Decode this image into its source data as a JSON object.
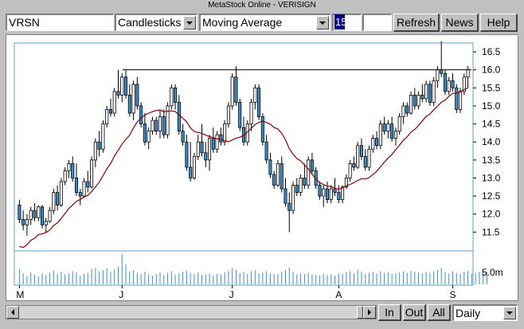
{
  "window": {
    "title": "MetaStock Online - VERISIGN"
  },
  "toolbar": {
    "symbol": "VRSN",
    "chart_type": "Candlesticks",
    "indicator": "Moving Average",
    "period": "15",
    "extra_field": "",
    "refresh_label": "Refresh",
    "news_label": "News",
    "help_label": "Help"
  },
  "footer": {
    "zoom_in_label": "In",
    "zoom_out_label": "Out",
    "all_label": "All",
    "interval": "Daily"
  },
  "icons": {
    "dropdown": "chevron-down-icon",
    "scroll_left": "arrow-left-icon",
    "scroll_right": "arrow-right-icon"
  },
  "colors": {
    "up": "#ffffff",
    "down": "#3a8fd0",
    "ma": "#8b0000",
    "frame": "#5ba0c8",
    "volume": "#3a8fd0",
    "resistance": "#000000"
  },
  "chart_data": {
    "type": "candlestick",
    "title": "",
    "symbol": "VRSN",
    "y_ticks": [
      "16.5",
      "16.0",
      "15.5",
      "15.0",
      "14.5",
      "14.0",
      "13.5",
      "13.0",
      "12.5",
      "12.0",
      "11.5"
    ],
    "y_range": [
      11.0,
      16.7
    ],
    "volume_label": "5.0m",
    "x_month_labels": [
      {
        "label": "M",
        "index": 0
      },
      {
        "label": "J",
        "index": 27
      },
      {
        "label": "J",
        "index": 56
      },
      {
        "label": "A",
        "index": 84
      },
      {
        "label": "S",
        "index": 114
      }
    ],
    "moving_average_period": 15,
    "resistance_level": 16.0,
    "resistance_from_index": 28,
    "candles": [
      [
        12.25,
        12.4,
        11.75,
        11.85
      ],
      [
        11.85,
        12.1,
        11.55,
        11.7
      ],
      [
        11.7,
        12.0,
        11.4,
        11.85
      ],
      [
        11.85,
        12.2,
        11.7,
        12.1
      ],
      [
        12.1,
        12.3,
        11.8,
        11.9
      ],
      [
        11.9,
        12.25,
        11.8,
        12.2
      ],
      [
        12.2,
        12.25,
        11.6,
        11.7
      ],
      [
        11.7,
        11.9,
        11.5,
        11.8
      ],
      [
        11.8,
        12.2,
        11.75,
        12.1
      ],
      [
        12.1,
        12.7,
        12.0,
        12.6
      ],
      [
        12.6,
        12.8,
        12.1,
        12.25
      ],
      [
        12.25,
        13.0,
        12.2,
        12.9
      ],
      [
        12.9,
        13.3,
        12.8,
        13.2
      ],
      [
        13.2,
        13.5,
        13.0,
        13.4
      ],
      [
        13.4,
        13.6,
        12.9,
        13.0
      ],
      [
        13.0,
        13.4,
        12.5,
        12.6
      ],
      [
        12.6,
        12.7,
        12.25,
        12.5
      ],
      [
        12.5,
        13.0,
        12.45,
        12.9
      ],
      [
        12.9,
        13.2,
        12.6,
        12.75
      ],
      [
        12.75,
        13.6,
        12.7,
        13.5
      ],
      [
        13.5,
        14.1,
        13.3,
        14.0
      ],
      [
        14.0,
        14.3,
        13.6,
        13.8
      ],
      [
        13.8,
        14.6,
        13.7,
        14.5
      ],
      [
        14.5,
        15.0,
        14.4,
        14.9
      ],
      [
        14.9,
        15.2,
        14.7,
        14.8
      ],
      [
        14.8,
        15.5,
        14.7,
        15.4
      ],
      [
        15.4,
        16.0,
        15.2,
        15.3
      ],
      [
        15.3,
        15.9,
        15.1,
        15.8
      ],
      [
        15.8,
        16.0,
        15.2,
        15.3
      ],
      [
        15.3,
        15.6,
        14.7,
        14.8
      ],
      [
        14.8,
        15.7,
        14.6,
        15.6
      ],
      [
        15.6,
        15.8,
        14.9,
        15.0
      ],
      [
        15.0,
        15.1,
        14.4,
        14.5
      ],
      [
        14.5,
        14.8,
        13.9,
        14.0
      ],
      [
        14.0,
        14.4,
        13.8,
        14.3
      ],
      [
        14.3,
        14.7,
        14.2,
        14.6
      ],
      [
        14.6,
        14.7,
        14.2,
        14.3
      ],
      [
        14.3,
        14.9,
        14.1,
        14.7
      ],
      [
        14.7,
        14.9,
        14.1,
        14.2
      ],
      [
        14.2,
        15.1,
        14.1,
        15.0
      ],
      [
        15.0,
        15.6,
        14.9,
        15.5
      ],
      [
        15.5,
        15.6,
        14.9,
        15.1
      ],
      [
        15.1,
        15.3,
        14.2,
        14.3
      ],
      [
        14.3,
        14.5,
        13.9,
        14.0
      ],
      [
        14.0,
        14.2,
        13.2,
        13.3
      ],
      [
        13.3,
        14.0,
        12.9,
        13.0
      ],
      [
        13.0,
        13.7,
        12.95,
        13.6
      ],
      [
        13.6,
        14.2,
        13.5,
        14.0
      ],
      [
        14.0,
        14.5,
        13.6,
        13.7
      ],
      [
        13.7,
        14.0,
        13.3,
        13.5
      ],
      [
        13.5,
        14.2,
        13.2,
        14.1
      ],
      [
        14.1,
        14.4,
        13.7,
        13.8
      ],
      [
        13.8,
        14.3,
        13.7,
        14.2
      ],
      [
        14.2,
        14.4,
        13.9,
        14.0
      ],
      [
        14.0,
        14.6,
        13.9,
        14.5
      ],
      [
        14.5,
        15.1,
        14.4,
        15.0
      ],
      [
        15.0,
        15.9,
        14.9,
        15.8
      ],
      [
        15.8,
        16.1,
        15.0,
        15.1
      ],
      [
        15.1,
        15.2,
        14.3,
        14.4
      ],
      [
        14.4,
        14.7,
        13.9,
        14.0
      ],
      [
        14.0,
        14.6,
        13.9,
        14.5
      ],
      [
        14.5,
        15.2,
        14.3,
        15.1
      ],
      [
        15.1,
        15.6,
        14.9,
        15.5
      ],
      [
        15.5,
        15.6,
        14.6,
        14.7
      ],
      [
        14.7,
        14.8,
        13.9,
        14.0
      ],
      [
        14.0,
        14.2,
        13.4,
        13.5
      ],
      [
        13.5,
        13.7,
        13.0,
        13.1
      ],
      [
        13.1,
        13.2,
        12.7,
        12.8
      ],
      [
        12.8,
        13.5,
        12.75,
        13.4
      ],
      [
        13.4,
        13.6,
        12.6,
        12.7
      ],
      [
        12.7,
        13.0,
        12.2,
        12.3
      ],
      [
        12.3,
        12.6,
        11.5,
        12.1
      ],
      [
        12.1,
        12.9,
        12.0,
        12.8
      ],
      [
        12.8,
        13.0,
        12.5,
        12.6
      ],
      [
        12.6,
        13.1,
        12.5,
        13.0
      ],
      [
        13.0,
        13.4,
        12.7,
        12.8
      ],
      [
        12.8,
        13.6,
        12.7,
        13.5
      ],
      [
        13.5,
        13.7,
        13.1,
        13.2
      ],
      [
        13.2,
        13.3,
        12.7,
        12.8
      ],
      [
        12.8,
        12.9,
        12.4,
        12.5
      ],
      [
        12.5,
        12.8,
        12.2,
        12.7
      ],
      [
        12.7,
        12.9,
        12.3,
        12.4
      ],
      [
        12.4,
        12.8,
        12.3,
        12.7
      ],
      [
        12.7,
        13.0,
        12.5,
        12.6
      ],
      [
        12.6,
        12.8,
        12.3,
        12.4
      ],
      [
        12.4,
        12.8,
        12.3,
        12.75
      ],
      [
        12.75,
        13.1,
        12.7,
        13.0
      ],
      [
        13.0,
        13.5,
        12.9,
        13.4
      ],
      [
        13.4,
        13.6,
        13.2,
        13.3
      ],
      [
        13.3,
        14.0,
        13.25,
        13.9
      ],
      [
        13.9,
        14.1,
        13.5,
        13.6
      ],
      [
        13.6,
        13.8,
        13.2,
        13.3
      ],
      [
        13.3,
        13.9,
        13.2,
        13.8
      ],
      [
        13.8,
        14.2,
        13.7,
        14.1
      ],
      [
        14.1,
        14.3,
        13.8,
        13.9
      ],
      [
        13.9,
        14.6,
        13.8,
        14.5
      ],
      [
        14.5,
        14.7,
        14.2,
        14.3
      ],
      [
        14.3,
        14.6,
        14.1,
        14.5
      ],
      [
        14.5,
        14.7,
        14.0,
        14.1
      ],
      [
        14.1,
        14.4,
        13.9,
        14.3
      ],
      [
        14.3,
        14.8,
        14.2,
        14.7
      ],
      [
        14.7,
        15.1,
        14.5,
        15.0
      ],
      [
        15.0,
        15.1,
        14.7,
        14.8
      ],
      [
        14.8,
        15.4,
        14.75,
        15.3
      ],
      [
        15.3,
        15.5,
        14.9,
        15.0
      ],
      [
        15.0,
        15.4,
        14.9,
        15.3
      ],
      [
        15.3,
        15.6,
        15.1,
        15.2
      ],
      [
        15.2,
        15.7,
        15.1,
        15.6
      ],
      [
        15.6,
        15.7,
        15.0,
        15.1
      ],
      [
        15.1,
        15.8,
        15.0,
        15.7
      ],
      [
        15.7,
        16.1,
        15.5,
        16.0
      ],
      [
        16.0,
        16.8,
        15.8,
        15.9
      ],
      [
        15.9,
        16.0,
        15.3,
        15.4
      ],
      [
        15.4,
        15.8,
        15.3,
        15.7
      ],
      [
        15.7,
        15.9,
        15.4,
        15.5
      ],
      [
        15.5,
        15.6,
        14.8,
        14.9
      ],
      [
        14.9,
        15.5,
        14.8,
        15.4
      ],
      [
        15.4,
        15.9,
        15.3,
        15.8
      ],
      [
        15.8,
        16.1,
        15.5,
        16.0
      ]
    ],
    "volume": [
      2.8,
      2.0,
      1.5,
      2.2,
      1.8,
      1.4,
      2.0,
      1.7,
      2.1,
      2.5,
      1.9,
      2.3,
      1.8,
      2.0,
      2.4,
      2.2,
      1.6,
      1.9,
      2.1,
      2.8,
      3.0,
      2.4,
      2.6,
      2.9,
      2.3,
      2.7,
      3.2,
      5.5,
      3.6,
      2.4,
      2.6,
      2.1,
      1.9,
      2.3,
      1.8,
      1.6,
      1.9,
      2.2,
      1.7,
      2.1,
      2.4,
      1.8,
      2.0,
      2.3,
      2.5,
      2.1,
      1.9,
      2.2,
      1.7,
      1.8,
      2.0,
      1.6,
      1.9,
      1.8,
      2.2,
      2.5,
      3.0,
      2.7,
      2.1,
      2.3,
      1.9,
      2.4,
      2.6,
      2.0,
      2.2,
      2.4,
      2.0,
      1.8,
      1.9,
      2.3,
      2.6,
      3.1,
      2.2,
      1.8,
      2.0,
      1.9,
      2.1,
      1.8,
      1.7,
      1.6,
      1.9,
      1.7,
      1.8,
      1.6,
      2.0,
      1.9,
      2.2,
      2.4,
      2.0,
      2.6,
      2.3,
      1.9,
      2.1,
      2.3,
      2.0,
      2.4,
      2.1,
      2.2,
      1.9,
      2.0,
      2.2,
      2.4,
      2.1,
      2.5,
      2.3,
      2.2,
      2.0,
      2.3,
      2.1,
      2.4,
      2.6,
      3.0,
      2.2,
      2.0,
      2.4,
      2.1,
      1.9,
      2.3,
      2.5,
      2.0,
      2.1,
      2.3,
      2.4,
      2.2
    ]
  }
}
